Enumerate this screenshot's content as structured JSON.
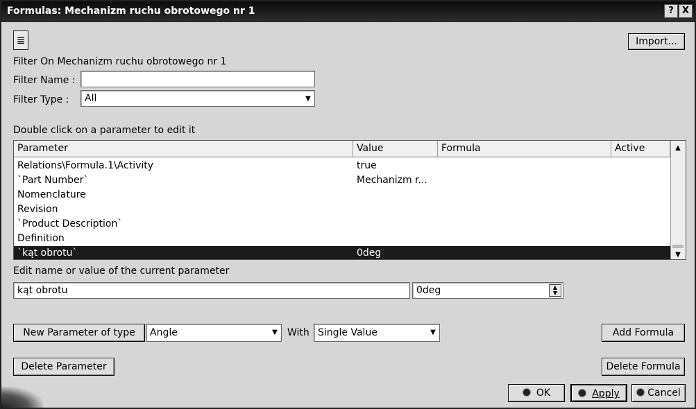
{
  "window": {
    "title": "Formulas: Mechanizm ruchu obrotowego nr 1",
    "help_glyph": "?",
    "close_glyph": "X"
  },
  "icons": {
    "formula_toolbar_icon": "formula-filter-icon",
    "formula_toolbar_glyph": "≣"
  },
  "toolbar": {
    "import_label": "Import..."
  },
  "filter": {
    "heading": "Filter On Mechanizm ruchu obrotowego nr 1",
    "name_label": "Filter Name :",
    "name_value": "",
    "type_label": "Filter Type :",
    "type_value": "All"
  },
  "table": {
    "instruction": "Double click on a parameter to edit it",
    "columns": [
      "Parameter",
      "Value",
      "Formula",
      "Active"
    ],
    "rows": [
      {
        "parameter": "Relations\\Formula.1\\Activity",
        "value": "true",
        "formula": "",
        "active": ""
      },
      {
        "parameter": "`Part Number`",
        "value": "Mechanizm r...",
        "formula": "",
        "active": ""
      },
      {
        "parameter": "Nomenclature",
        "value": "",
        "formula": "",
        "active": ""
      },
      {
        "parameter": "Revision",
        "value": "",
        "formula": "",
        "active": ""
      },
      {
        "parameter": "`Product Description`",
        "value": "",
        "formula": "",
        "active": ""
      },
      {
        "parameter": "Definition",
        "value": "",
        "formula": "",
        "active": ""
      },
      {
        "parameter": "`kąt obrotu`",
        "value": "0deg",
        "formula": "",
        "active": ""
      }
    ],
    "selected_row": 6
  },
  "edit": {
    "label": "Edit name or value of the current parameter",
    "name_value": "kąt obrotu",
    "value_value": "0deg"
  },
  "new_param": {
    "button_label": "New Parameter of type",
    "type_value": "Angle",
    "with_label": "With",
    "with_value": "Single Value"
  },
  "buttons": {
    "add_formula": "Add Formula",
    "delete_parameter": "Delete Parameter",
    "delete_formula": "Delete Formula",
    "ok": "OK",
    "apply": "Apply",
    "cancel": "Cancel"
  }
}
